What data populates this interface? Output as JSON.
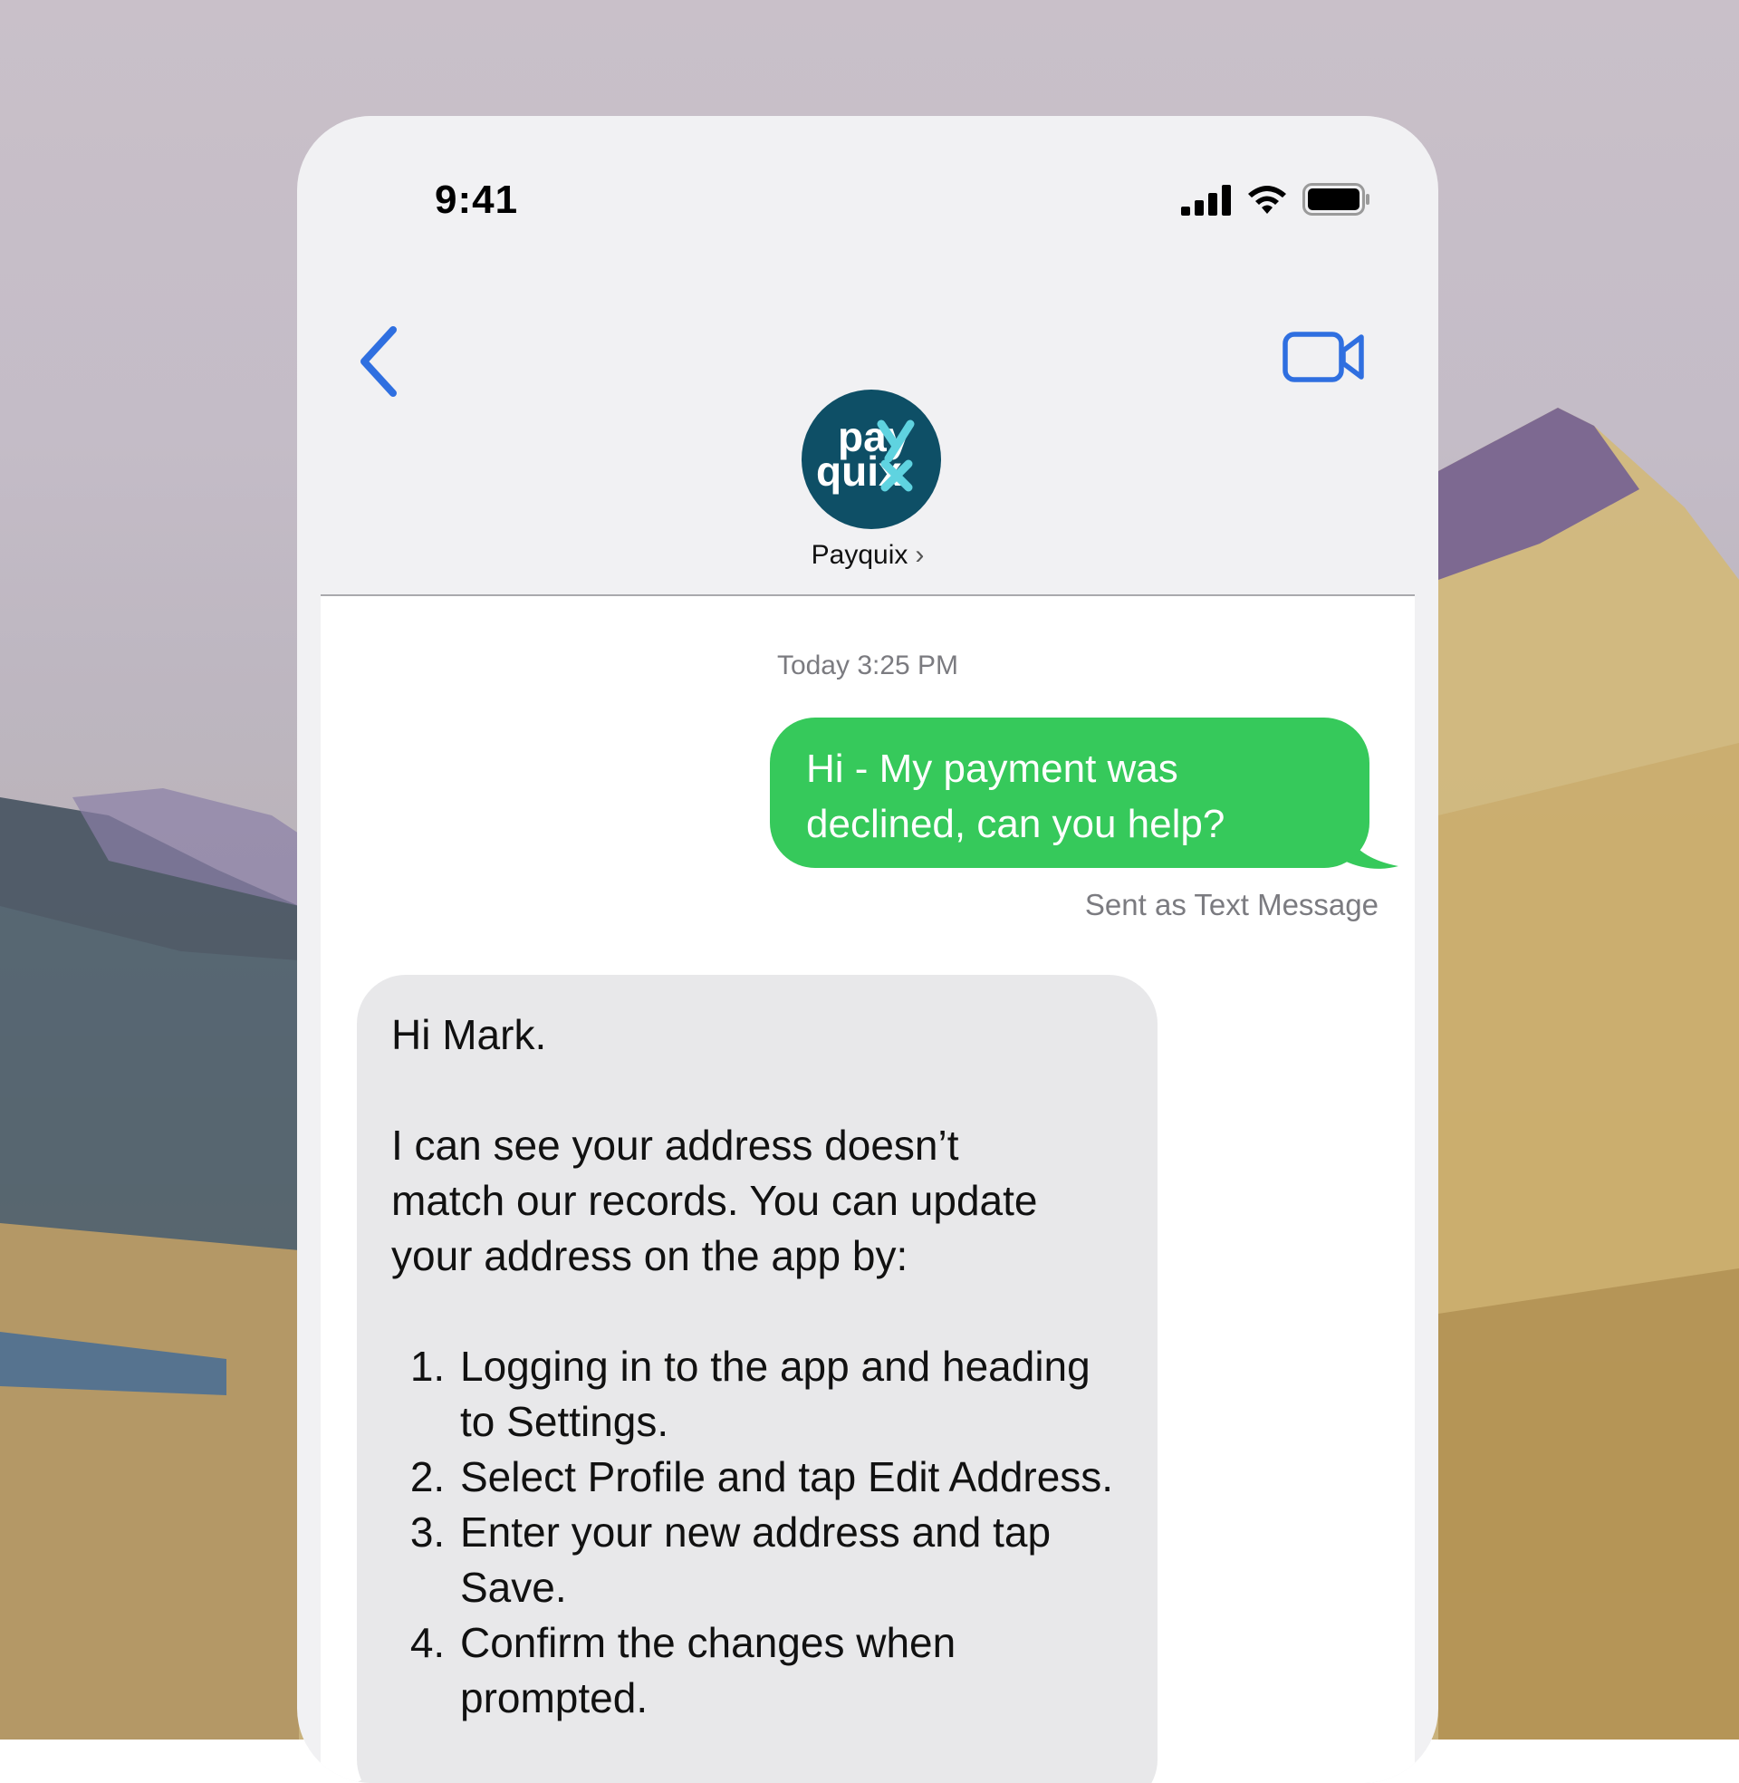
{
  "status_bar": {
    "time": "9:41"
  },
  "header": {
    "contact_name": "Payquix",
    "avatar_text_top": "pay",
    "avatar_text_bottom": "quix"
  },
  "thread": {
    "timestamp": "Today 3:25 PM",
    "outgoing": {
      "line1": "Hi - My payment was",
      "line2": "declined, can you help?",
      "delivery_note": "Sent as Text Message"
    },
    "incoming": {
      "greeting": "Hi Mark.",
      "body_line1": "I can see your address doesn’t",
      "body_line2": "match our records. You can update",
      "body_line3": "your address on the app by:",
      "steps": [
        "Logging in to the app and heading to Settings.",
        "Select Profile and tap Edit Address.",
        "Enter your new address and tap Save.",
        "Confirm the changes when prompted."
      ]
    }
  },
  "colors": {
    "outgoing_bubble": "#36c95b",
    "incoming_bubble": "#e8e8ea",
    "ios_blue": "#2f6fe0",
    "avatar_bg": "#0e4f66",
    "avatar_accent": "#5fd3e0"
  },
  "icons": {
    "back": "chevron-left-icon",
    "video": "video-camera-icon",
    "signal": "cellular-signal-icon",
    "wifi": "wifi-icon",
    "battery": "battery-icon"
  }
}
